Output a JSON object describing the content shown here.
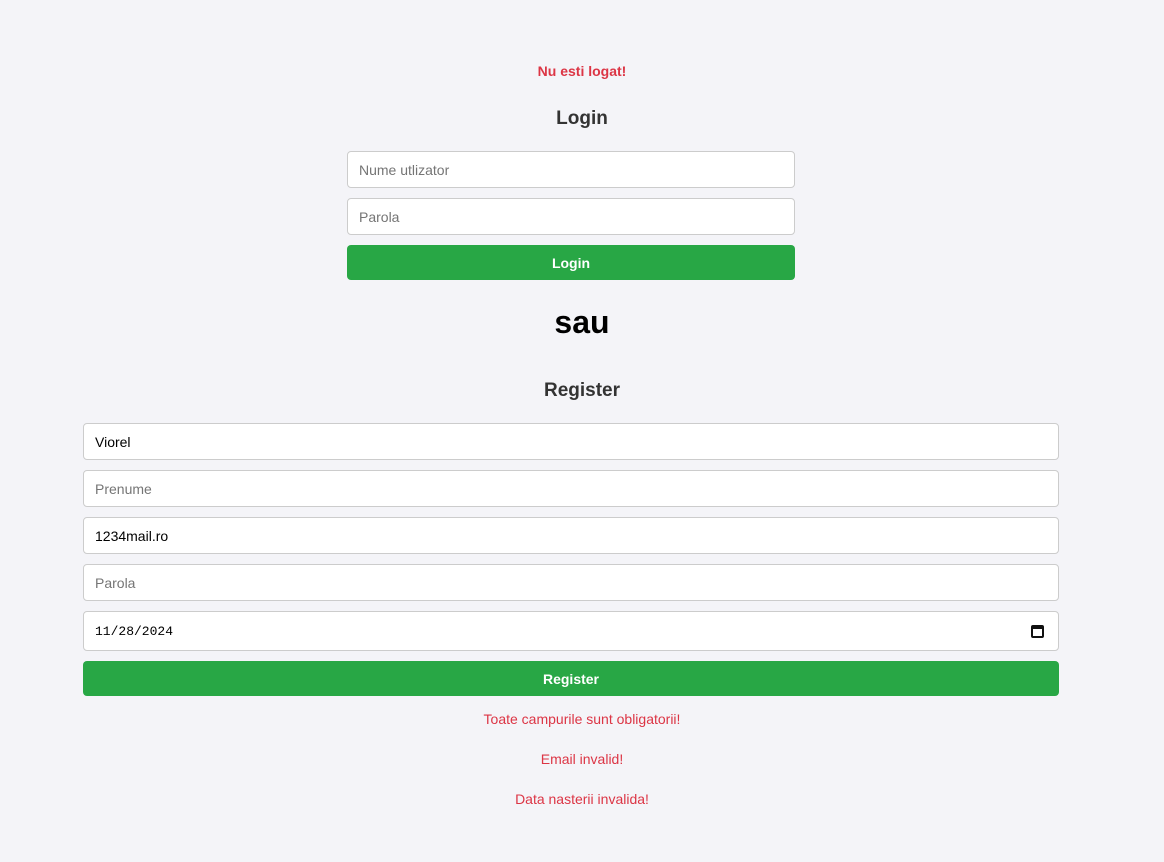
{
  "status_message": "Nu esti logat!",
  "login": {
    "title": "Login",
    "username_placeholder": "Nume utlizator",
    "password_placeholder": "Parola",
    "button_label": "Login"
  },
  "separator": "sau",
  "register": {
    "title": "Register",
    "nume_value": "Viorel",
    "prenume_placeholder": "Prenume",
    "email_value": "1234mail.ro",
    "password_placeholder": "Parola",
    "birthdate_value": "11/28/2024",
    "button_label": "Register"
  },
  "errors": [
    "Toate campurile sunt obligatorii!",
    "Email invalid!",
    "Data nasterii invalida!"
  ],
  "colors": {
    "accent_green": "#28a745",
    "error_red": "#dc3545",
    "background": "#f4f4f8"
  },
  "icons": {
    "date_picker": "calendar-icon"
  }
}
